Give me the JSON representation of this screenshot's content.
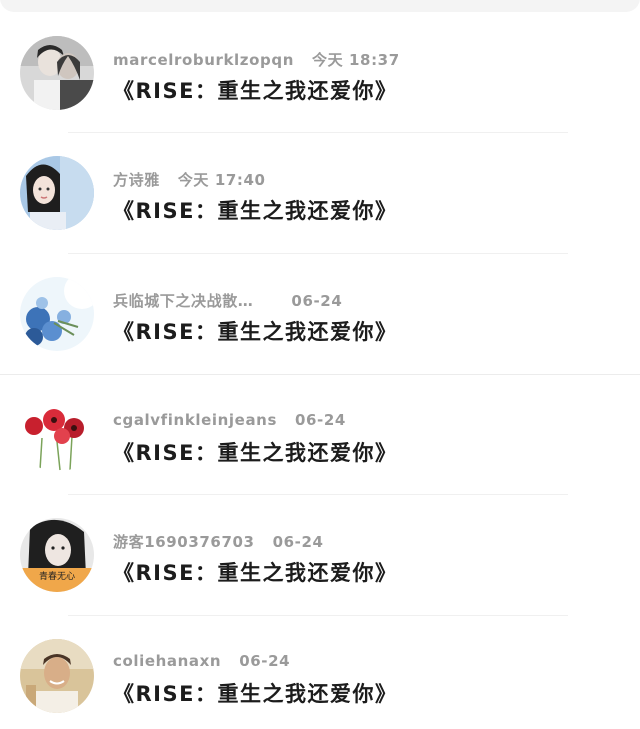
{
  "comments": [
    {
      "username": "marcelroburklzopqn",
      "time": "今天 18:37",
      "title": "《RISE：重生之我还爱你》",
      "avatar": "couple-photo-avatar"
    },
    {
      "username": "方诗雅",
      "time": "今天 17:40",
      "title": "《RISE：重生之我还爱你》",
      "avatar": "girl-portrait-avatar"
    },
    {
      "username": "兵临城下之决战散…",
      "time": "06-24",
      "title": "《RISE：重生之我还爱你》",
      "avatar": "blue-flowers-avatar"
    },
    {
      "username": "cgalvfinkleinjeans",
      "time": "06-24",
      "title": "《RISE：重生之我还爱你》",
      "avatar": "red-poppies-avatar"
    },
    {
      "username": "游客1690376703",
      "time": "06-24",
      "title": "《RISE：重生之我还爱你》",
      "avatar": "dark-hair-girl-avatar"
    },
    {
      "username": "coliehanaxn",
      "time": "06-24",
      "title": "《RISE：重生之我还爱你》",
      "avatar": "smiling-man-avatar"
    }
  ],
  "avatar_caption": "青春无心",
  "colors": {
    "username": "#9a9a9a",
    "title": "#1c1c1c",
    "divider": "#f0f0f0",
    "top_card": "#f4f4f4"
  }
}
